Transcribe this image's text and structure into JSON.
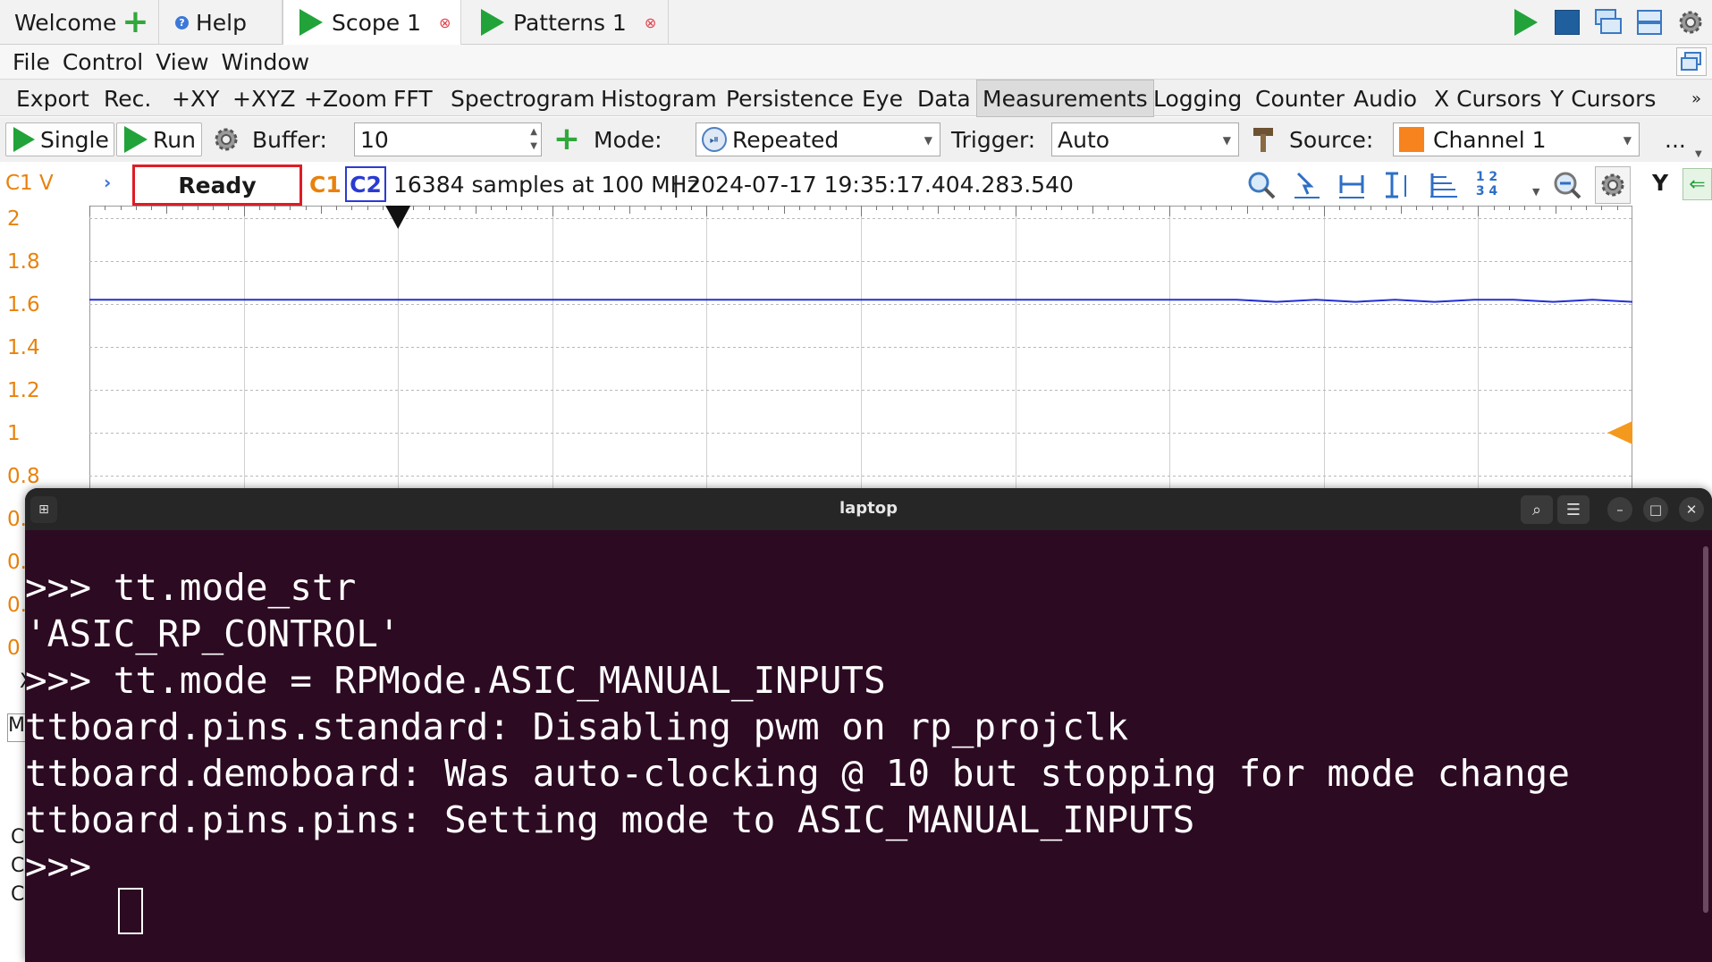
{
  "tabs": [
    {
      "label": "Welcome",
      "icon": "plus-icon"
    },
    {
      "label": "Help",
      "icon": "help-icon"
    },
    {
      "label": "Scope 1",
      "icon": "play-icon",
      "active": true
    },
    {
      "label": "Patterns 1",
      "icon": "play-icon"
    }
  ],
  "menu": [
    "File",
    "Control",
    "View",
    "Window"
  ],
  "instruments": [
    "Export",
    "Rec.",
    "+XY",
    "+XYZ",
    "+Zoom",
    "FFT",
    "Spectrogram",
    "Histogram",
    "Persistence",
    "Eye",
    "Data",
    "Measurements",
    "Logging",
    "Counter",
    "Audio",
    "X Cursors",
    "Y Cursors"
  ],
  "instruments_more": "»",
  "controls": {
    "single_label": "Single",
    "run_label": "Run",
    "buffer_label": "Buffer:",
    "buffer_value": "10",
    "mode_label": "Mode:",
    "mode_value": "Repeated",
    "trigger_label": "Trigger:",
    "trigger_value": "Auto",
    "source_label": "Source:",
    "source_value": "Channel 1",
    "more": "..."
  },
  "status": {
    "axis_label": "C1 V",
    "state": "Ready",
    "ch1": "C1",
    "ch2": "C2",
    "info": "16384 samples at 100 MHz",
    "timestamp": "| 2024-07-17 19:35:17.404.283.540",
    "y_button": "Y"
  },
  "y_ticks": [
    "2",
    "1.8",
    "1.6",
    "1.4",
    "1.2",
    "1",
    "0.8",
    "0.",
    "0.",
    "0.",
    "0"
  ],
  "left_partials": [
    "X",
    "M",
    "C",
    "C",
    "C"
  ],
  "chart_data": {
    "type": "line",
    "series": [
      {
        "values": [
          1.62,
          1.62,
          1.62,
          1.62,
          1.62,
          1.62,
          1.62,
          1.62,
          1.62,
          1.62,
          1.62,
          1.62,
          1.62,
          1.62,
          1.62,
          1.62,
          1.62,
          1.62,
          1.62,
          1.62,
          1.62,
          1.62,
          1.62,
          1.62,
          1.62,
          1.62,
          1.62,
          1.62,
          1.62,
          1.62,
          1.61,
          1.62,
          1.61,
          1.62,
          1.61,
          1.62,
          1.62,
          1.61,
          1.62,
          1.61
        ]
      }
    ],
    "ylim": [
      0,
      2
    ],
    "grid": true
  },
  "colors": {
    "axis_orange": "#e8820c",
    "trace_blue": "#2230d6",
    "ready_border": "#e01b24",
    "terminal_bg": "#2c0a22",
    "ch2_blue": "#2b3bd1"
  },
  "terminal": {
    "title": "laptop",
    "lines": [
      ">>> tt.mode_str",
      "'ASIC_RP_CONTROL'",
      ">>> tt.mode = RPMode.ASIC_MANUAL_INPUTS",
      "ttboard.pins.standard: Disabling pwm on rp_projclk",
      "ttboard.demoboard: Was auto-clocking @ 10 but stopping for mode change",
      "ttboard.pins.pins: Setting mode to ASIC_MANUAL_INPUTS",
      ">>> "
    ]
  }
}
